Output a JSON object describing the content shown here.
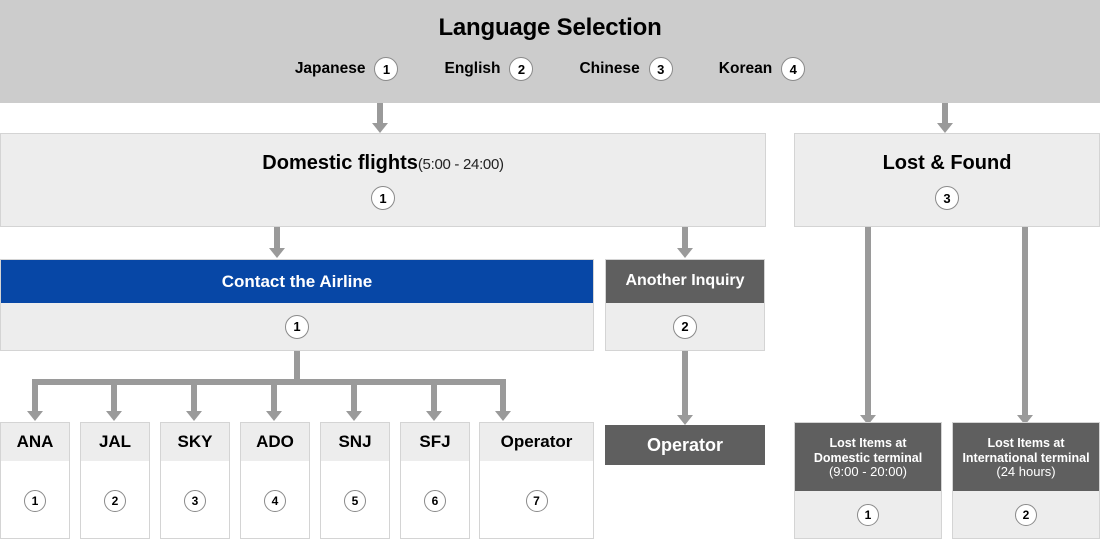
{
  "header": {
    "title": "Language Selection",
    "languages": [
      {
        "label": "Japanese",
        "number": "1"
      },
      {
        "label": "English",
        "number": "2"
      },
      {
        "label": "Chinese",
        "number": "3"
      },
      {
        "label": "Korean",
        "number": "4"
      }
    ]
  },
  "level1": {
    "domestic": {
      "title": "Domestic flights",
      "hours": "(5:00 - 24:00)",
      "number": "1"
    },
    "lost_found": {
      "title": "Lost & Found",
      "number": "3"
    }
  },
  "level2": {
    "contact_airline": {
      "title": "Contact the Airline",
      "number": "1",
      "color": "#0747a6"
    },
    "another_inquiry": {
      "title": "Another Inquiry",
      "number": "2",
      "color": "#5f5f5f"
    }
  },
  "level3": {
    "airlines": [
      {
        "label": "ANA",
        "number": "1"
      },
      {
        "label": "JAL",
        "number": "2"
      },
      {
        "label": "SKY",
        "number": "3"
      },
      {
        "label": "ADO",
        "number": "4"
      },
      {
        "label": "SNJ",
        "number": "5"
      },
      {
        "label": "SFJ",
        "number": "6"
      },
      {
        "label": "Operator",
        "number": "7"
      }
    ],
    "operator_bar": {
      "title": "Operator"
    },
    "lost_items": [
      {
        "line1": "Lost Items at",
        "line2": "Domestic terminal",
        "hours": "(9:00 - 20:00)",
        "number": "1"
      },
      {
        "line1": "Lost Items at",
        "line2": "International terminal",
        "hours": "(24 hours)",
        "number": "2"
      }
    ]
  },
  "colors": {
    "header_band": "#cccccc",
    "box_grey": "#ededed",
    "dark_grey": "#5f5f5f",
    "connector": "#9a9a9a",
    "accent_blue": "#0747a6"
  }
}
